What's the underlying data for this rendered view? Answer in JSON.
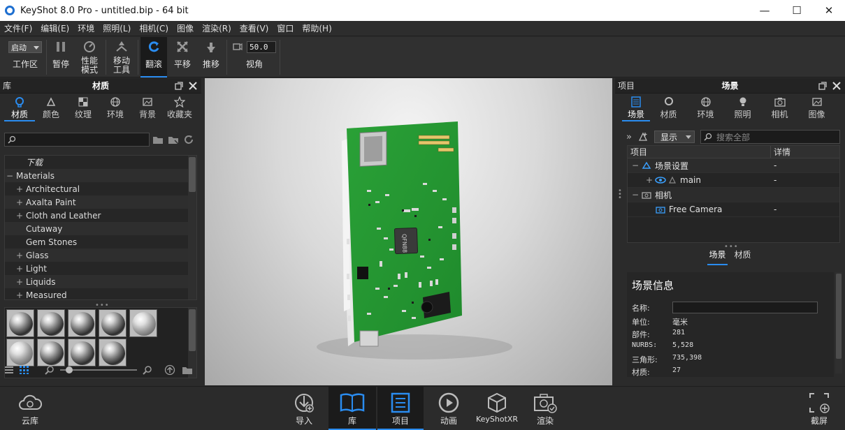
{
  "titlebar": {
    "title": "KeyShot 8.0 Pro  - untitled.bip  - 64 bit",
    "minimize": "—",
    "maximize": "☐",
    "close": "✕"
  },
  "menu": [
    "文件(F)",
    "编辑(E)",
    "环境",
    "照明(L)",
    "相机(C)",
    "图像",
    "渲染(R)",
    "查看(V)",
    "窗口",
    "帮助(H)"
  ],
  "toolbar": {
    "workspace_value": "启动",
    "workspace_label": "工作区",
    "pause_label": "暂停",
    "perf_label_1": "性能",
    "perf_label_2": "模式",
    "move_label_1": "移动",
    "move_label_2": "工具",
    "tumble_label": "翻滚",
    "pan_label": "平移",
    "dolly_label": "推移",
    "fov_value": "50.0",
    "fov_label": "视角"
  },
  "library": {
    "head_left": "库",
    "head_title": "材质",
    "tabs": [
      "材质",
      "颜色",
      "纹理",
      "环境",
      "背景",
      "收藏夹"
    ],
    "tree": [
      {
        "label": "下载",
        "expander": "",
        "italic": true,
        "indent": 1
      },
      {
        "label": "Materials",
        "expander": "−",
        "italic": false,
        "indent": 0
      },
      {
        "label": "Architectural",
        "expander": "+",
        "italic": false,
        "indent": 1
      },
      {
        "label": "Axalta Paint",
        "expander": "+",
        "italic": false,
        "indent": 1
      },
      {
        "label": "Cloth and Leather",
        "expander": "+",
        "italic": false,
        "indent": 1
      },
      {
        "label": "Cutaway",
        "expander": "",
        "italic": false,
        "indent": 1
      },
      {
        "label": "Gem Stones",
        "expander": "",
        "italic": false,
        "indent": 1
      },
      {
        "label": "Glass",
        "expander": "+",
        "italic": false,
        "indent": 1
      },
      {
        "label": "Light",
        "expander": "+",
        "italic": false,
        "indent": 1
      },
      {
        "label": "Liquids",
        "expander": "+",
        "italic": false,
        "indent": 1
      },
      {
        "label": "Measured",
        "expander": "+",
        "italic": false,
        "indent": 1
      }
    ],
    "material_count": 9
  },
  "board": {
    "chip_label": "QFN88"
  },
  "project": {
    "head_left": "项目",
    "head_title": "场景",
    "tabs": [
      "场景",
      "材质",
      "环境",
      "照明",
      "相机",
      "图像"
    ],
    "display_value": "显示",
    "search_placeholder": "搜索全部",
    "col_item": "项目",
    "col_detail": "详情",
    "rows": [
      {
        "expander": "−",
        "label": "场景设置",
        "detail": "-",
        "indent": 0
      },
      {
        "expander": "+",
        "label": "main",
        "detail": "-",
        "indent": 1
      },
      {
        "expander": "−",
        "label": "相机",
        "detail": "",
        "indent": 0
      },
      {
        "expander": "",
        "label": "Free Camera",
        "detail": "-",
        "indent": 1
      }
    ],
    "subtabs": [
      "场景",
      "材质"
    ],
    "info": {
      "title": "场景信息",
      "name_label": "名称:",
      "unit_label": "单位:",
      "unit_value": "毫米",
      "parts_label": "部件:",
      "parts_value": "281",
      "nurbs_label": "NURBS:",
      "nurbs_value": "5,528",
      "tri_label": "三角形:",
      "tri_value": "735,398",
      "mat_label": "材质:",
      "mat_value": "27"
    }
  },
  "bottombar": {
    "cloud": "云库",
    "import": "导入",
    "library": "库",
    "project": "项目",
    "animation": "动画",
    "keyshotxr": "KeyShotXR",
    "render": "渲染",
    "screenshot": "截屏"
  },
  "colors": {
    "accent": "#2a8cf0",
    "pcb_green": "#2fa33a"
  }
}
